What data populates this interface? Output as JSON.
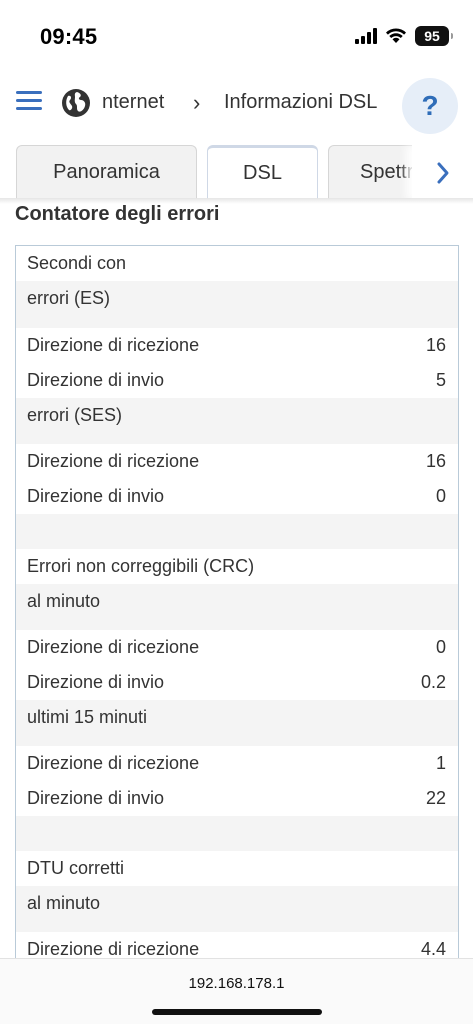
{
  "status": {
    "time": "09:45",
    "battery": "95"
  },
  "header": {
    "breadcrumb_1": "nternet",
    "breadcrumb_sep": "›",
    "breadcrumb_2": "Informazioni DSL",
    "help": "?"
  },
  "tabs": [
    {
      "label": "Panoramica"
    },
    {
      "label": "DSL"
    },
    {
      "label": "Spettro"
    }
  ],
  "section": {
    "title": "Contatore degli errori"
  },
  "rows": [
    {
      "label": "Secondi con",
      "value": ""
    },
    {
      "label": "errori (ES)",
      "value": ""
    },
    {
      "label": "",
      "value": ""
    },
    {
      "label": "Direzione di ricezione",
      "value": "16"
    },
    {
      "label": "Direzione di invio",
      "value": "5"
    },
    {
      "label": "errori (SES)",
      "value": ""
    },
    {
      "label": "",
      "value": ""
    },
    {
      "label": "Direzione di ricezione",
      "value": "16"
    },
    {
      "label": "Direzione di invio",
      "value": "0"
    },
    {
      "label": "",
      "value": ""
    },
    {
      "label": "",
      "value": ""
    },
    {
      "label": "Errori non correggibili (CRC)",
      "value": ""
    },
    {
      "label": "al minuto",
      "value": ""
    },
    {
      "label": "",
      "value": ""
    },
    {
      "label": "Direzione di ricezione",
      "value": "0"
    },
    {
      "label": "Direzione di invio",
      "value": "0.2"
    },
    {
      "label": "ultimi 15 minuti",
      "value": ""
    },
    {
      "label": "",
      "value": ""
    },
    {
      "label": "Direzione di ricezione",
      "value": "1"
    },
    {
      "label": "Direzione di invio",
      "value": "22"
    },
    {
      "label": "",
      "value": ""
    },
    {
      "label": "",
      "value": ""
    },
    {
      "label": "DTU corretti",
      "value": ""
    },
    {
      "label": "al minuto",
      "value": ""
    },
    {
      "label": "",
      "value": ""
    },
    {
      "label": "Direzione di ricezione",
      "value": "4.4"
    }
  ],
  "bottom": {
    "url": "192.168.178.1"
  },
  "colors": {
    "accent": "#3a6fbd",
    "row_shade": "#f4f4f4",
    "panel_border": "#b9cad8"
  },
  "icons": [
    "cellular-signal-icon",
    "wifi-icon",
    "battery-icon",
    "menu-icon",
    "globe-icon",
    "chevron-right-icon",
    "help-icon"
  ]
}
